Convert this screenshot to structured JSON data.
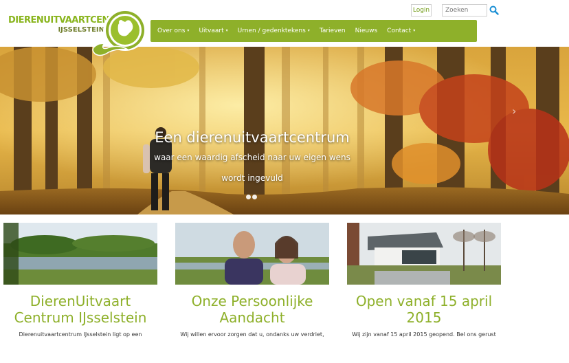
{
  "logo": {
    "line1": "DIERENUITVAARTCENTRUM",
    "line2": "IJSSELSTEIN",
    "icon": "pet-silhouette-logo-icon"
  },
  "topbar": {
    "login_label": "Login",
    "search_placeholder": "Zoeken",
    "search_icon": "search-icon"
  },
  "nav": {
    "items": [
      {
        "label": "Over ons",
        "dropdown": true
      },
      {
        "label": "Uitvaart",
        "dropdown": true
      },
      {
        "label": "Urnen / gedenktekens",
        "dropdown": true
      },
      {
        "label": "Tarieven",
        "dropdown": false
      },
      {
        "label": "Nieuws",
        "dropdown": false
      },
      {
        "label": "Contact",
        "dropdown": true
      }
    ],
    "caret": "▾"
  },
  "hero": {
    "title": "Een dierenuitvaartcentrum",
    "subtitle1": "waar een waardig afscheid naar uw eigen wens",
    "subtitle2": "wordt ingevuld",
    "slides_count": 2,
    "next_arrow": "›"
  },
  "cards": [
    {
      "title": "DierenUitvaart Centrum IJsselstein",
      "text": "Dierenuitvaartcentrum IJsselstein ligt op een",
      "image": "river-landscape-image"
    },
    {
      "title": "Onze Persoonlijke Aandacht",
      "text": "Wij willen ervoor zorgen dat u, ondanks uw verdriet,",
      "image": "owners-portrait-image"
    },
    {
      "title": "Open vanaf 15 april 2015",
      "text": "Wij zijn vanaf 15 april 2015 geopend. Bel ons gerust",
      "image": "building-exterior-image"
    }
  ],
  "colors": {
    "brand_green": "#8eb02a",
    "logo_green": "#8ab51f",
    "search_blue": "#1a8fd4"
  }
}
